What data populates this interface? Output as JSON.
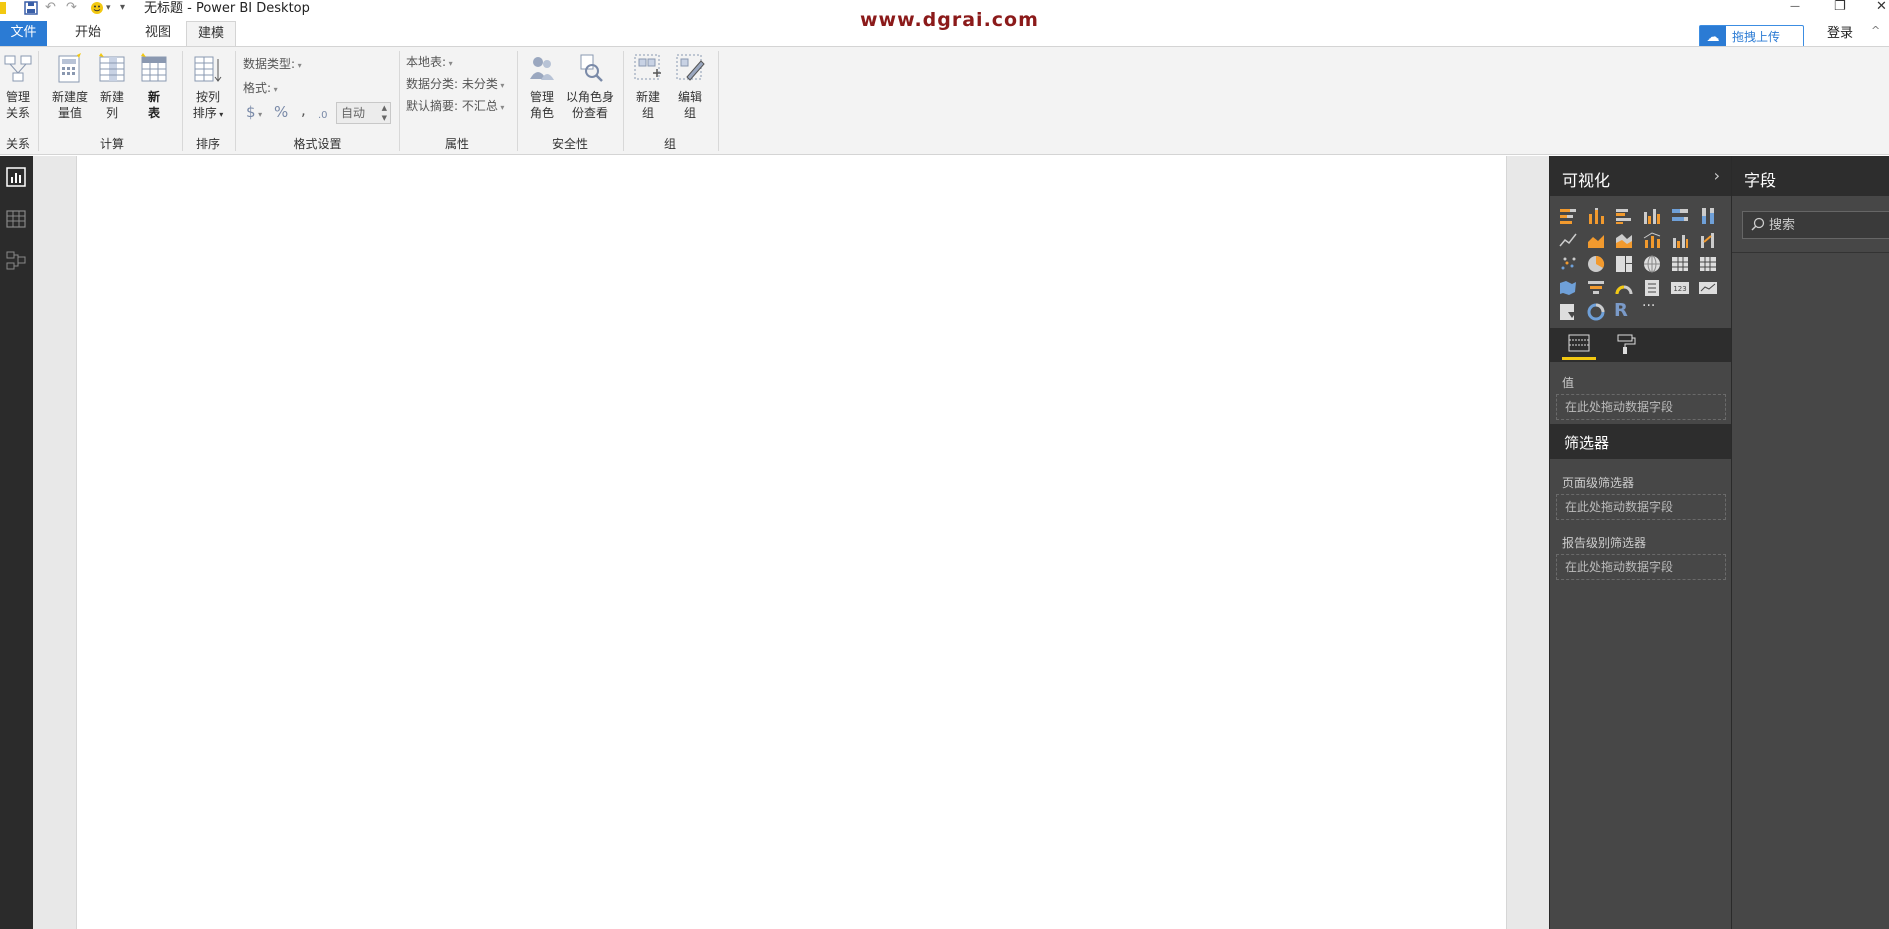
{
  "window": {
    "title": "无标题 - Power BI Desktop",
    "watermark": "www.dgrai.com",
    "minimize": "—",
    "restore": "❐",
    "close": "✕"
  },
  "quick_access": {
    "save_icon": "save-icon",
    "undo_icon": "undo-icon",
    "redo_icon": "redo-icon",
    "smiley_icon": "smiley-icon",
    "customize_icon": "customize-quick-access-icon"
  },
  "tabs": [
    {
      "label": "文件"
    },
    {
      "label": "开始"
    },
    {
      "label": "视图"
    },
    {
      "label": "建模"
    }
  ],
  "header_right": {
    "upload_label": "拖拽上传",
    "login_label": "登录",
    "collapse_glyph": "^"
  },
  "ribbon": {
    "groups": {
      "relations": "关系",
      "calculate": "计算",
      "sort": "排序",
      "format_settings": "格式设置",
      "properties": "属性",
      "security": "安全性",
      "group": "组"
    },
    "buttons": {
      "manage_relations": [
        "管理",
        "关系"
      ],
      "new_measure": [
        "新建度",
        "量值"
      ],
      "new_column": [
        "新建",
        "列"
      ],
      "new_table": [
        "新",
        "表"
      ],
      "sort_by_column": [
        "按列",
        "排序"
      ],
      "manage_roles": [
        "管理",
        "角色"
      ],
      "view_as_roles": [
        "以角色身",
        "份查看"
      ],
      "new_group": [
        "新建",
        "组"
      ],
      "edit_group": [
        "编辑",
        "组"
      ]
    },
    "format": {
      "data_type": "数据类型:",
      "format": "格式:",
      "currency": "$",
      "percent": "%",
      "comma": ",",
      "decimal": ".0",
      "auto": "自动"
    },
    "properties": {
      "home_table": "本地表:",
      "data_category": "数据分类: 未分类",
      "default_summary": "默认摘要: 不汇总"
    }
  },
  "visualizations": {
    "title": "可视化",
    "values_label": "值",
    "drop_placeholder": "在此处拖动数据字段",
    "filters_title": "筛选器",
    "page_filters": "页面级筛选器",
    "report_filters": "报告级别筛选器",
    "r_label": "R",
    "more_label": "···"
  },
  "fields": {
    "title": "字段",
    "search_placeholder": "搜索"
  }
}
